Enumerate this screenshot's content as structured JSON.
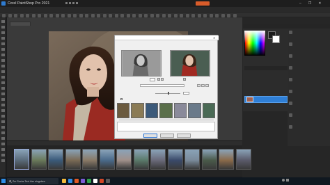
{
  "window": {
    "title": "Corel PaintShop Pro 2021",
    "title_suffix": "",
    "doc_tab": "",
    "tb_right_text": "",
    "tb_button_color": "#d95c2a",
    "controls": {
      "minimize": "–",
      "maximize": "❐",
      "close": "✕"
    }
  },
  "menu": [
    "",
    "",
    "",
    "",
    "",
    "",
    "",
    "",
    "",
    "",
    "",
    "",
    ""
  ],
  "dialog": {
    "title": "",
    "left_label": "",
    "right_label": "",
    "zoom_value": "",
    "labels": [
      "",
      "",
      ""
    ],
    "checkbox_label": "",
    "description": "",
    "buttons": [
      "",
      "",
      ""
    ]
  },
  "right_panel": {
    "header": "",
    "tabs": [
      "",
      "",
      ""
    ],
    "layer_name": ""
  },
  "fx_panel": {
    "header": "",
    "items": [
      "",
      "",
      "",
      "",
      "",
      "",
      "",
      "",
      ""
    ]
  },
  "organizer": {
    "tabs": [
      "",
      "",
      ""
    ],
    "thumb_count": 14
  },
  "taskbar": {
    "search_placeholder": "Zur Suche Text hier eingeben",
    "time": "",
    "date": "",
    "tray_text": "",
    "icon_colors": [
      "#f3b93b",
      "#2f8ee8",
      "#e25a24",
      "#7c5cd6",
      "#2fa14a",
      "#ffffff",
      "#d24726",
      "#5a5a5a"
    ]
  }
}
